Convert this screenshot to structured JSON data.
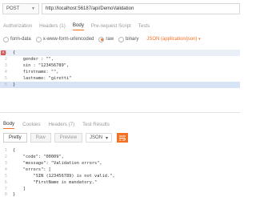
{
  "request": {
    "method": "POST",
    "url": "http://localhost:56187/api/DemoValidation"
  },
  "request_tabs": [
    {
      "label": "Authorization",
      "count": ""
    },
    {
      "label": "Headers",
      "count": "(1)"
    },
    {
      "label": "Body",
      "count": ""
    },
    {
      "label": "Pre-request Script",
      "count": ""
    },
    {
      "label": "Tests",
      "count": ""
    }
  ],
  "body_options": {
    "form_data": "form-data",
    "urlencoded": "x-www-form-urlencoded",
    "raw": "raw",
    "binary": "binary",
    "content_type": "JSON (application/json)"
  },
  "request_body": {
    "lines": [
      {
        "n": "1",
        "text": "{"
      },
      {
        "n": "2",
        "text": "    gender : \"\","
      },
      {
        "n": "3",
        "text": "    sin : \"123456789\","
      },
      {
        "n": "4",
        "text": "    firstname: \"\","
      },
      {
        "n": "5",
        "text": "    lastname: \"giretti\""
      },
      {
        "n": "6",
        "text": "}"
      }
    ]
  },
  "response_tabs": [
    {
      "label": "Body",
      "count": ""
    },
    {
      "label": "Cookies",
      "count": ""
    },
    {
      "label": "Headers",
      "count": "(7)"
    },
    {
      "label": "Test Results",
      "count": ""
    }
  ],
  "response_toolbar": {
    "pretty": "Pretty",
    "raw": "Raw",
    "preview": "Preview",
    "format": "JSON"
  },
  "response_body": {
    "lines": [
      {
        "n": "1",
        "text": "{"
      },
      {
        "n": "2",
        "text": "    \"code\": \"00009\","
      },
      {
        "n": "3",
        "text": "    \"message\": \"Validation errors\","
      },
      {
        "n": "4",
        "text": "    \"errors\": ["
      },
      {
        "n": "5",
        "text": "        \"SIN (123456789) is not valid.\","
      },
      {
        "n": "6",
        "text": "        \"FirstName is mandatory.\""
      },
      {
        "n": "7",
        "text": "    ]"
      },
      {
        "n": "8",
        "text": "}"
      }
    ]
  },
  "colors": {
    "accent": "#f47023",
    "error": "#d9534f",
    "highlight": "#d8e4f5"
  }
}
